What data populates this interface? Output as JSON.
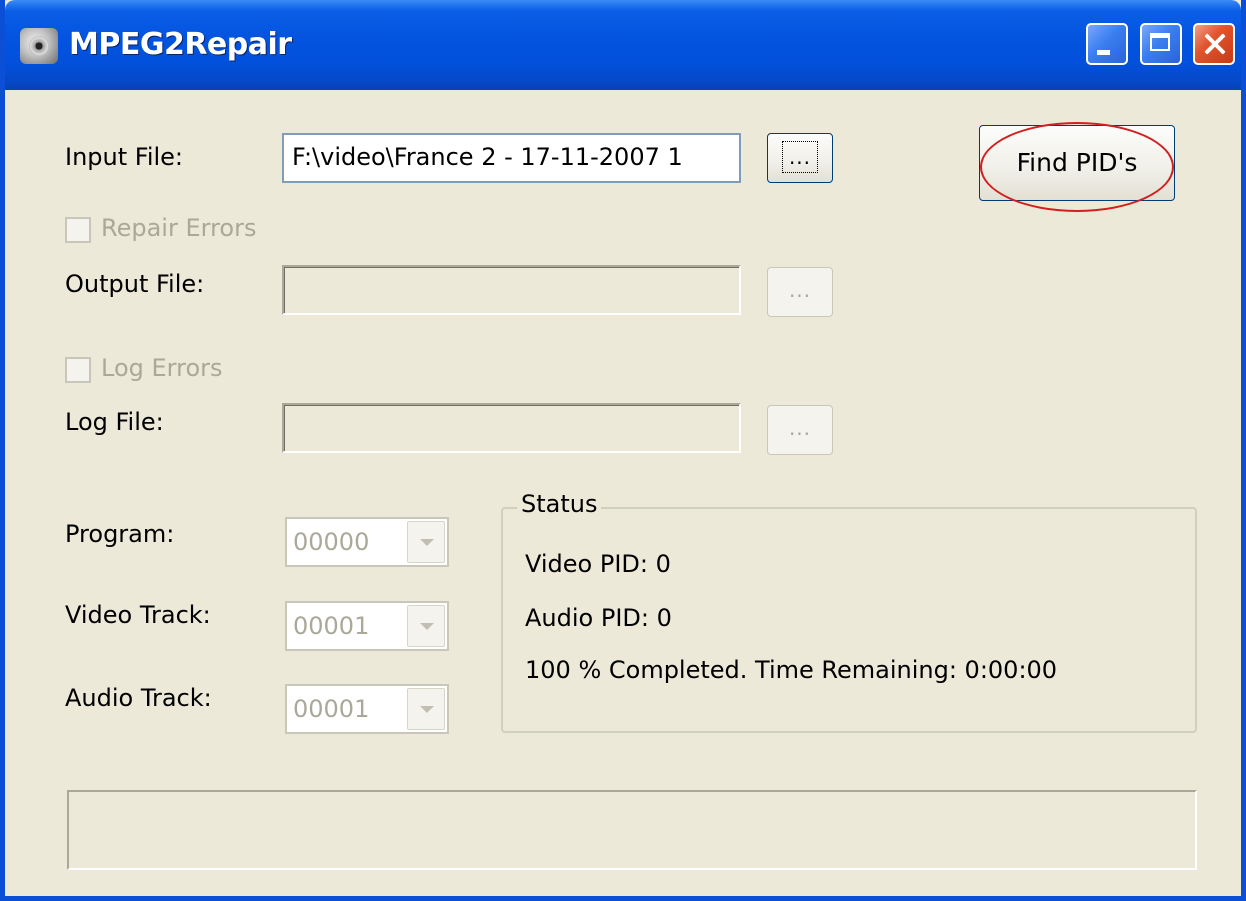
{
  "window": {
    "title": "MPEG2Repair",
    "icon": "mpeg2repair-app-icon",
    "titlebar_color": "#0454e0",
    "buttons": [
      "minimize-icon",
      "maximize-icon",
      "close-icon"
    ]
  },
  "input": {
    "label": "Input File:",
    "value": "F:\\video\\France 2 - 17-11-2007 1",
    "browse_label": "..."
  },
  "find_pids": {
    "label": "Find PID's",
    "annotation_color": "#d02020"
  },
  "repair": {
    "checkbox_label": "Repair Errors",
    "checked": false
  },
  "output": {
    "label": "Output File:",
    "value": "",
    "browse_label": "..."
  },
  "log": {
    "checkbox_label": "Log Errors",
    "checked": false,
    "label": "Log File:",
    "value": "",
    "browse_label": "..."
  },
  "program": {
    "label": "Program:",
    "value": "00000"
  },
  "video_track": {
    "label": "Video Track:",
    "value": "00001"
  },
  "audio_track": {
    "label": "Audio Track:",
    "value": "00001"
  },
  "status": {
    "title": "Status",
    "video_pid": "Video PID: 0",
    "audio_pid": "Audio PID: 0",
    "progress": "100 % Completed.  Time Remaining: 0:00:00"
  },
  "statusbar": {
    "text": ""
  }
}
